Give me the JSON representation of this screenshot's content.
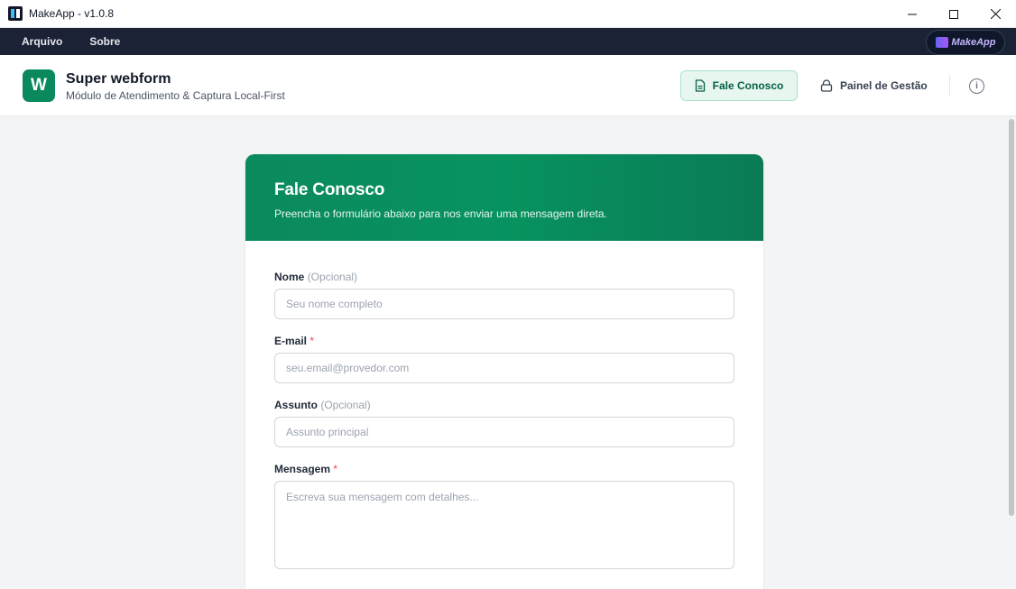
{
  "window": {
    "title": "MakeApp - v1.0.8",
    "controls": [
      "minimize",
      "maximize",
      "close"
    ]
  },
  "menubar": {
    "items": [
      {
        "label": "Arquivo"
      },
      {
        "label": "Sobre"
      }
    ],
    "brand": "MakeApp"
  },
  "header": {
    "logo_letter": "W",
    "title": "Super webform",
    "subtitle": "Módulo de Atendimento & Captura Local-First",
    "nav": [
      {
        "label": "Fale Conosco",
        "icon": "document-icon",
        "active": true
      },
      {
        "label": "Painel de Gestão",
        "icon": "lock-icon",
        "active": false
      }
    ],
    "info_icon": "info-icon"
  },
  "form": {
    "title": "Fale Conosco",
    "description": "Preencha o formulário abaixo para nos enviar uma mensagem direta.",
    "fields": [
      {
        "label": "Nome",
        "hint": "(Opcional)",
        "required": false,
        "placeholder": "Seu nome completo",
        "type": "text"
      },
      {
        "label": "E-mail",
        "hint": "*",
        "required": true,
        "placeholder": "seu.email@provedor.com",
        "type": "email"
      },
      {
        "label": "Assunto",
        "hint": "(Opcional)",
        "required": false,
        "placeholder": "Assunto principal",
        "type": "text"
      },
      {
        "label": "Mensagem",
        "hint": "*",
        "required": true,
        "placeholder": "Escreva sua mensagem com detalhes...",
        "type": "textarea"
      }
    ]
  },
  "colors": {
    "accent": "#0a8a5c",
    "menubar_bg": "#1b2235",
    "required": "#ef4444"
  }
}
